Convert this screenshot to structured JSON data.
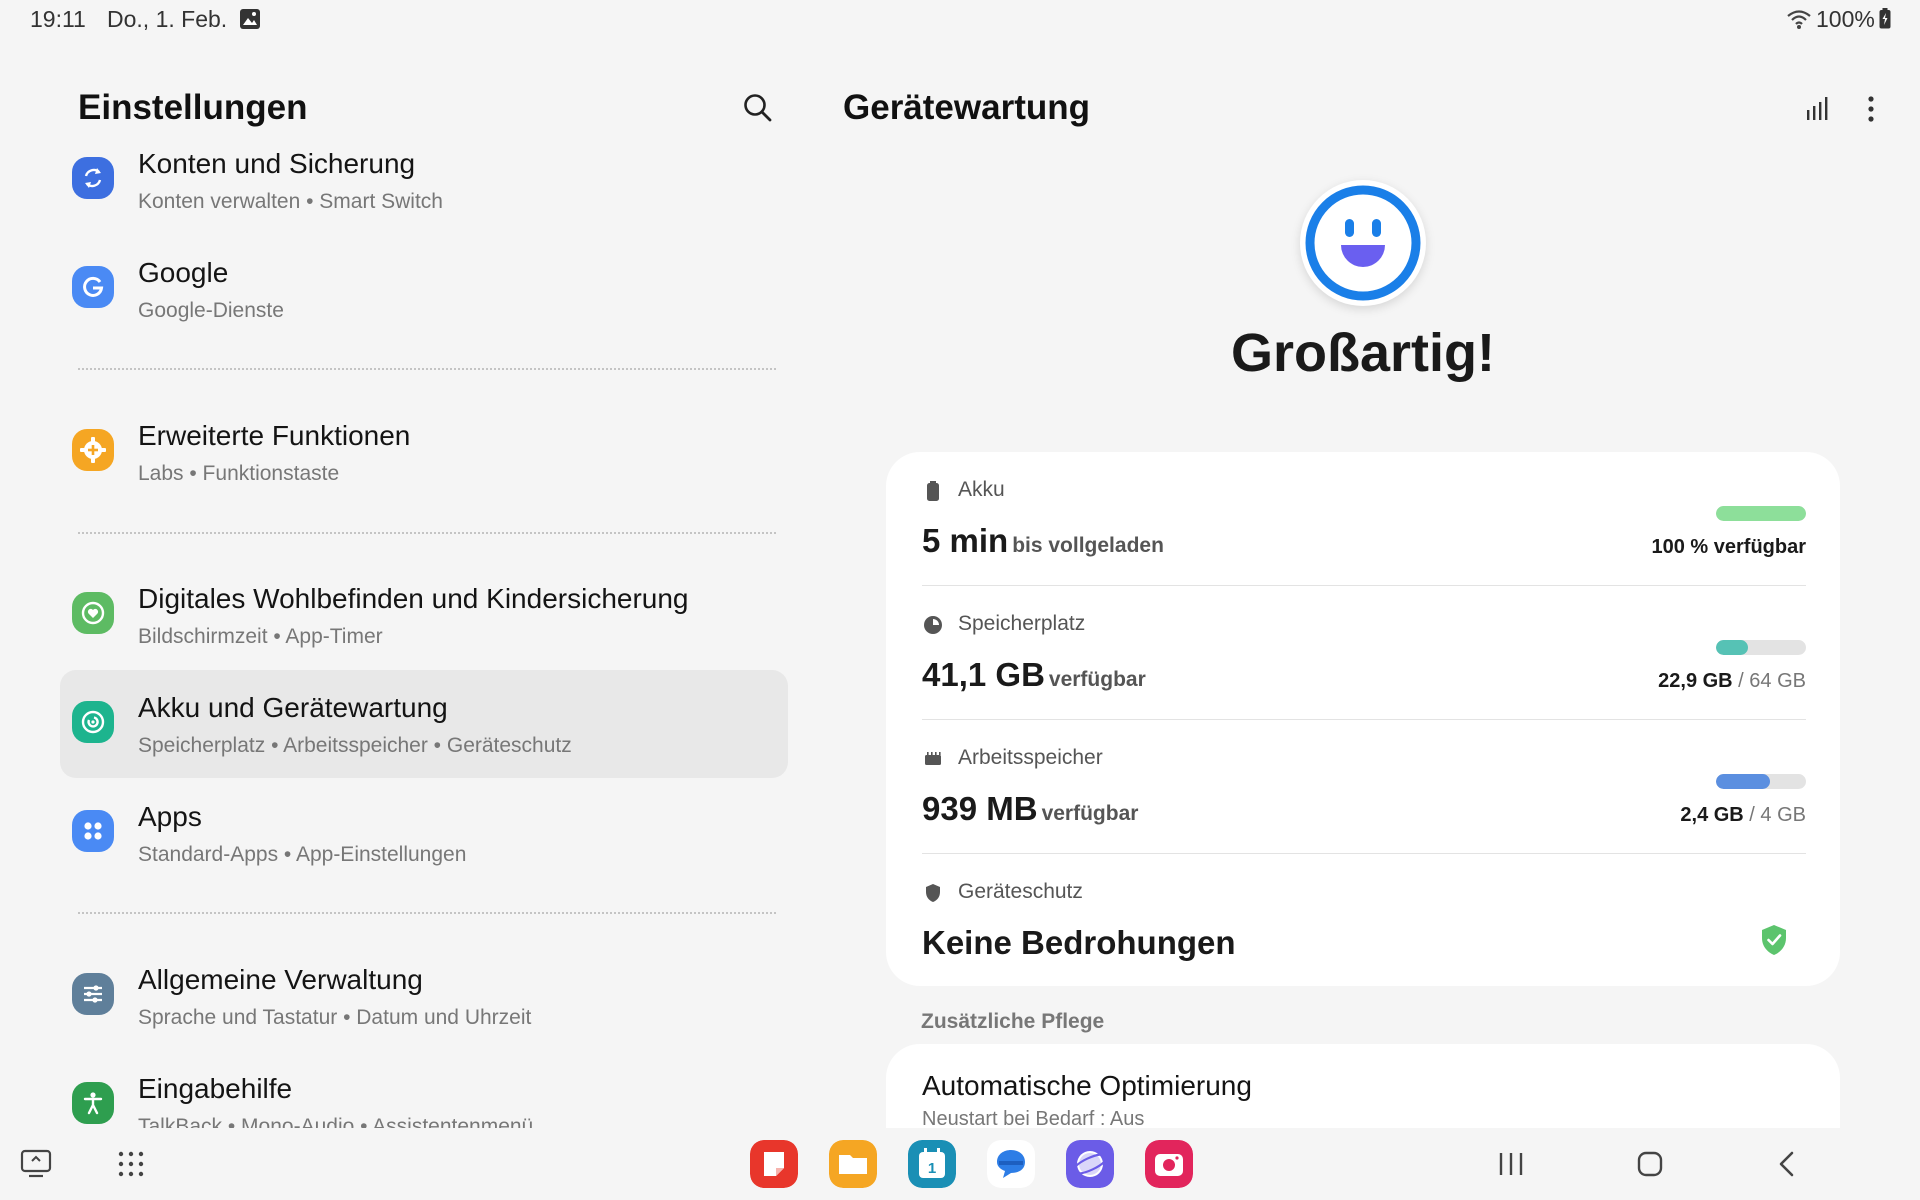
{
  "status_bar": {
    "time": "19:11",
    "date": "Do., 1. Feb.",
    "battery": "100%",
    "icons": [
      "image-icon",
      "wifi-icon",
      "battery-icon"
    ]
  },
  "left_pane": {
    "title": "Einstellungen",
    "items": [
      {
        "title": "Konten und Sicherung",
        "subtitle": "Konten verwalten  •  Smart Switch",
        "icon": "sync-icon",
        "color": "#3d6fe0"
      },
      {
        "title": "Google",
        "subtitle": "Google-Dienste",
        "icon": "google-icon",
        "color": "#4a8af4"
      },
      {
        "title": "Erweiterte Funktionen",
        "subtitle": "Labs  •  Funktionstaste",
        "icon": "gear-plus-icon",
        "color": "#f5a623"
      },
      {
        "title": "Digitales Wohlbefinden und Kindersicherung",
        "subtitle": "Bildschirmzeit  •  App-Timer",
        "icon": "heart-circle-icon",
        "color": "#5dbb63"
      },
      {
        "title": "Akku und Gerätewartung",
        "subtitle": "Speicherplatz  •  Arbeitsspeicher  •  Geräteschutz",
        "icon": "device-care-icon",
        "color": "#1db48e",
        "selected": true
      },
      {
        "title": "Apps",
        "subtitle": "Standard-Apps  •  App-Einstellungen",
        "icon": "apps-grid-icon",
        "color": "#4a8af4"
      },
      {
        "title": "Allgemeine Verwaltung",
        "subtitle": "Sprache und Tastatur  •  Datum und Uhrzeit",
        "icon": "sliders-icon",
        "color": "#5f7f9a"
      },
      {
        "title": "Eingabehilfe",
        "subtitle": "TalkBack  •  Mono-Audio  •  Assistentenmenü",
        "icon": "accessibility-icon",
        "color": "#2e9e4f"
      }
    ]
  },
  "right_pane": {
    "title": "Gerätewartung",
    "status": "Großartig!",
    "battery": {
      "label": "Akku",
      "value": "5 min",
      "suffix": "bis vollgeladen",
      "right": "100 % verfügbar",
      "level": 1.0,
      "color": "#8ddf9a"
    },
    "storage": {
      "label": "Speicherplatz",
      "value": "41,1 GB",
      "suffix": "verfügbar",
      "used": "22,9 GB",
      "sep": " / ",
      "total": "64 GB",
      "level": 0.36,
      "color": "#56c2b5"
    },
    "memory": {
      "label": "Arbeitsspeicher",
      "value": "939 MB",
      "suffix": "verfügbar",
      "used": "2,4 GB",
      "sep": " / ",
      "total": "4 GB",
      "level": 0.6,
      "color": "#5b8fe0"
    },
    "protection": {
      "label": "Geräteschutz",
      "value": "Keine Bedrohungen"
    },
    "extra_label": "Zusätzliche Pflege",
    "auto_opt": {
      "title": "Automatische Optimierung",
      "subtitle": "Neustart bei Bedarf : Aus"
    }
  },
  "nav_bar": {
    "apps": [
      {
        "name": "notes-app-icon",
        "color": "#e8362b"
      },
      {
        "name": "files-app-icon",
        "color": "#f5a623"
      },
      {
        "name": "calendar-app-icon",
        "color": "#1a8fb5",
        "text": "1"
      },
      {
        "name": "messages-app-icon",
        "color": "#2d7de6"
      },
      {
        "name": "internet-app-icon",
        "color": "#6b5ce7"
      },
      {
        "name": "camera-app-icon",
        "color": "#e2255c"
      }
    ]
  }
}
